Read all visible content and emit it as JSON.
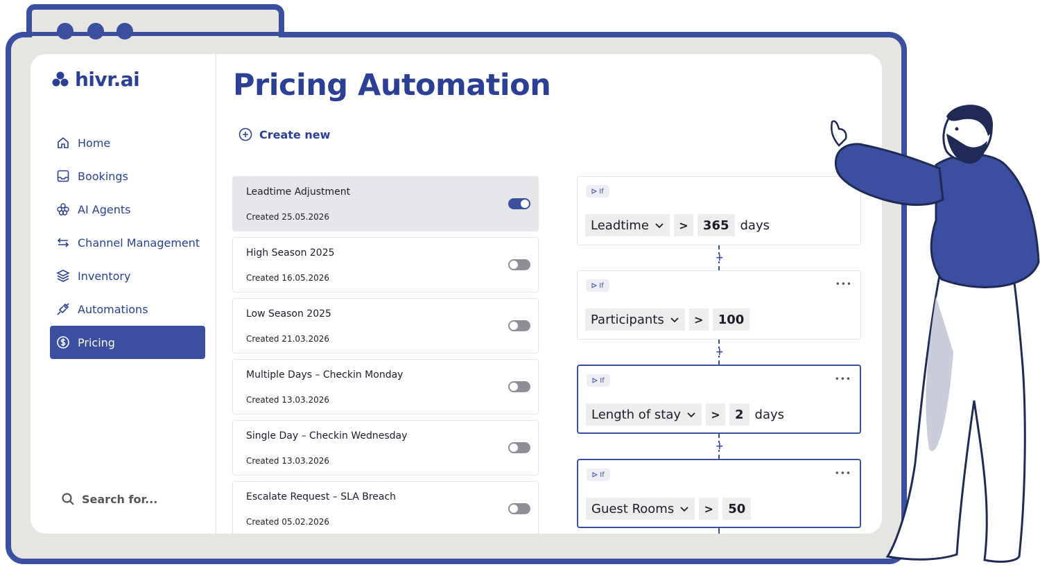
{
  "brand": {
    "name": "hivr.ai",
    "color": "#2b3f95"
  },
  "sidebar": {
    "items": [
      {
        "label": "Home",
        "icon": "home-icon",
        "active": false
      },
      {
        "label": "Bookings",
        "icon": "inbox-icon",
        "active": false
      },
      {
        "label": "AI Agents",
        "icon": "hexagons-icon",
        "active": false
      },
      {
        "label": "Channel Management",
        "icon": "arrows-swap-icon",
        "active": false
      },
      {
        "label": "Inventory",
        "icon": "layers-icon",
        "active": false
      },
      {
        "label": "Automations",
        "icon": "plug-icon",
        "active": false
      },
      {
        "label": "Pricing",
        "icon": "dollar-circle-icon",
        "active": true
      }
    ],
    "search_label": "Search for..."
  },
  "main": {
    "title": "Pricing Automation",
    "create_new": "Create new",
    "automations": [
      {
        "title": "Leadtime Adjustment",
        "created": "Created 25.05.2026",
        "enabled": true,
        "selected": true
      },
      {
        "title": "High Season 2025",
        "created": "Created 16.05.2026",
        "enabled": false,
        "selected": false
      },
      {
        "title": "Low Season 2025",
        "created": "Created 21.03.2026",
        "enabled": false,
        "selected": false
      },
      {
        "title": "Multiple Days – Checkin Monday",
        "created": "Created 13.03.2026",
        "enabled": false,
        "selected": false
      },
      {
        "title": "Single Day – Checkin Wednesday",
        "created": "Created 13.03.2026",
        "enabled": false,
        "selected": false
      },
      {
        "title": "Escalate Request – SLA Breach",
        "created": "Created 05.02.2026",
        "enabled": false,
        "selected": false
      }
    ],
    "rules": [
      {
        "badge": "If",
        "field": "Leadtime",
        "operator": ">",
        "value": "365",
        "unit": "days",
        "selected": false
      },
      {
        "badge": "If",
        "field": "Participants",
        "operator": ">",
        "value": "100",
        "unit": "",
        "selected": false
      },
      {
        "badge": "If",
        "field": "Length of stay",
        "operator": ">",
        "value": "2",
        "unit": "days",
        "selected": true
      },
      {
        "badge": "If",
        "field": "Guest Rooms",
        "operator": ">",
        "value": "50",
        "unit": "",
        "selected": true
      }
    ],
    "more_glyph": "•••",
    "plus_glyph": "+"
  },
  "colors": {
    "accent": "#3a4fa0",
    "frame": "#e6e5e1"
  }
}
